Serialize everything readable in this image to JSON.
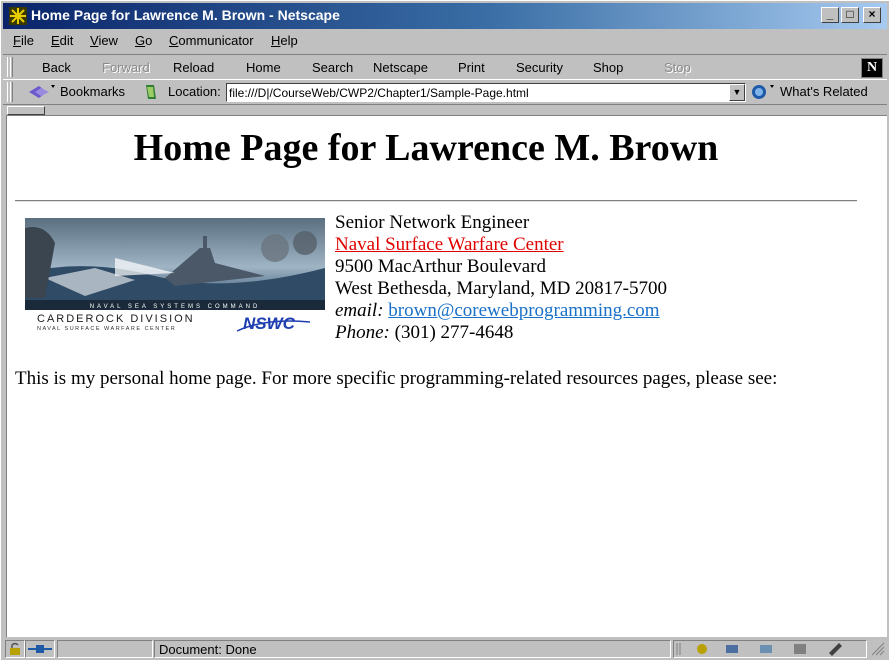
{
  "window": {
    "title": "Home Page for Lawrence M. Brown - Netscape"
  },
  "menu": [
    "File",
    "Edit",
    "View",
    "Go",
    "Communicator",
    "Help"
  ],
  "nav": {
    "back": "Back",
    "forward": "Forward",
    "reload": "Reload",
    "home": "Home",
    "search": "Search",
    "netscape": "Netscape",
    "print": "Print",
    "security": "Security",
    "shop": "Shop",
    "stop": "Stop"
  },
  "location": {
    "bookmarks": "Bookmarks",
    "label": "Location:",
    "url": "file:///D|/CourseWeb/CWP2/Chapter1/Sample-Page.html",
    "whats_related": "What's Related"
  },
  "page": {
    "heading": "Home Page for Lawrence M. Brown",
    "banner": {
      "line1": "NAVAL SEA SYSTEMS COMMAND",
      "line2": "CARDEROCK DIVISION",
      "line3": "NAVAL SURFACE WARFARE CENTER",
      "logo": "NSWC"
    },
    "job_title": "Senior Network Engineer",
    "org_link": "Naval Surface Warfare Center",
    "street": "9500 MacArthur Boulevard",
    "city": "West Bethesda, Maryland, MD 20817-5700",
    "email_label": "email:",
    "email": "brown@corewebprogramming.com",
    "phone_label": "Phone:",
    "phone": "(301) 277-4648",
    "paragraph": "This is my personal home page. For more specific programming-related resources pages, please see:"
  },
  "status": {
    "text": "Document: Done"
  },
  "colors": {
    "link_visited": "#e00000",
    "link": "#1870c8",
    "title_bar": "#0a246a"
  }
}
